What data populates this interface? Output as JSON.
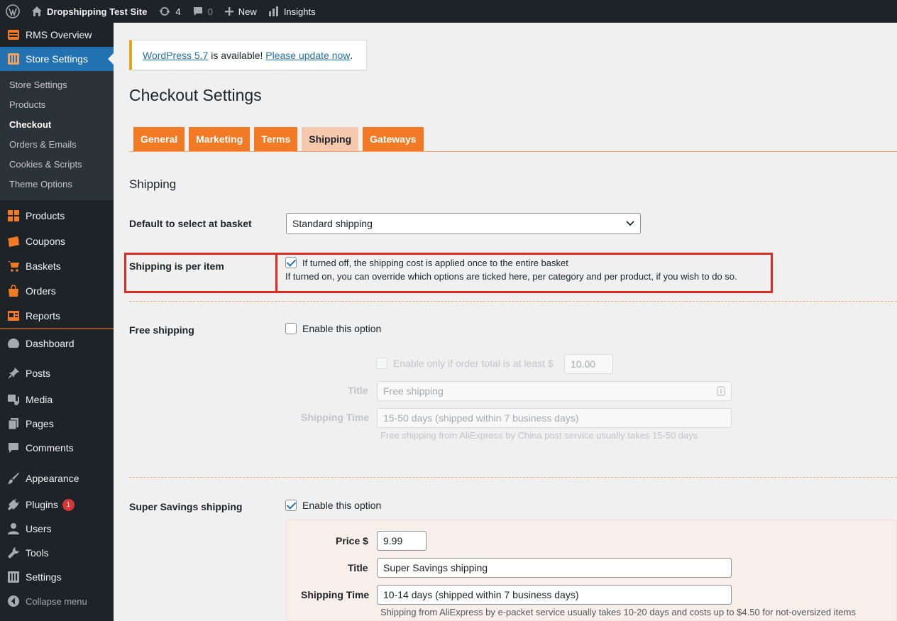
{
  "adminbar": {
    "site_name": "Dropshipping Test Site",
    "updates_count": "4",
    "comments_count": "0",
    "new_label": "New",
    "insights_label": "Insights"
  },
  "sidebar": {
    "rms_overview": "RMS Overview",
    "store_settings": "Store Settings",
    "submenu": [
      "Store Settings",
      "Products",
      "Checkout",
      "Orders & Emails",
      "Cookies & Scripts",
      "Theme Options"
    ],
    "store_items": [
      "Products",
      "Coupons",
      "Baskets",
      "Orders",
      "Reports"
    ],
    "dashboard": "Dashboard",
    "posts": "Posts",
    "media": "Media",
    "pages": "Pages",
    "comments": "Comments",
    "appearance": "Appearance",
    "plugins": "Plugins",
    "plugins_badge": "1",
    "users": "Users",
    "tools": "Tools",
    "settings": "Settings",
    "collapse": "Collapse menu"
  },
  "notice": {
    "link1": "WordPress 5.7",
    "middle": " is available! ",
    "link2": "Please update now",
    "end": "."
  },
  "page_title": "Checkout Settings",
  "tabs": [
    "General",
    "Marketing",
    "Terms",
    "Shipping",
    "Gateways"
  ],
  "active_tab": "Shipping",
  "section_title": "Shipping",
  "default_basket": {
    "label": "Default to select at basket",
    "value": "Standard shipping"
  },
  "per_item": {
    "label": "Shipping is per item",
    "checked": true,
    "text": "If turned off, the shipping cost is applied once to the entire basket",
    "help": "If turned on, you can override which options are ticked here, per category and per product, if you wish to do so."
  },
  "free_shipping": {
    "label": "Free shipping",
    "enable_text": "Enable this option",
    "enabled": false,
    "min_total_text": "Enable only if order total is at least $",
    "min_total_value": "10.00",
    "title_label": "Title",
    "title_placeholder": "Free shipping",
    "time_label": "Shipping Time",
    "time_value": "15-50 days (shipped within 7 business days)",
    "description": "Free shipping from AliExpress by China post service usually takes 15-50 days"
  },
  "super_savings": {
    "label": "Super Savings shipping",
    "enable_text": "Enable this option",
    "enabled": true,
    "price_label": "Price $",
    "price_value": "9.99",
    "title_label": "Title",
    "title_value": "Super Savings shipping",
    "time_label": "Shipping Time",
    "time_value": "10-14 days (shipped within 7 business days)",
    "description": "Shipping from AliExpress by e-packet service usually takes 10-20 days and costs up to $4.50 for not-oversized items"
  },
  "colors": {
    "accent_orange": "#f37a24",
    "wp_blue": "#2271b1",
    "highlight_red": "#e02b20"
  }
}
